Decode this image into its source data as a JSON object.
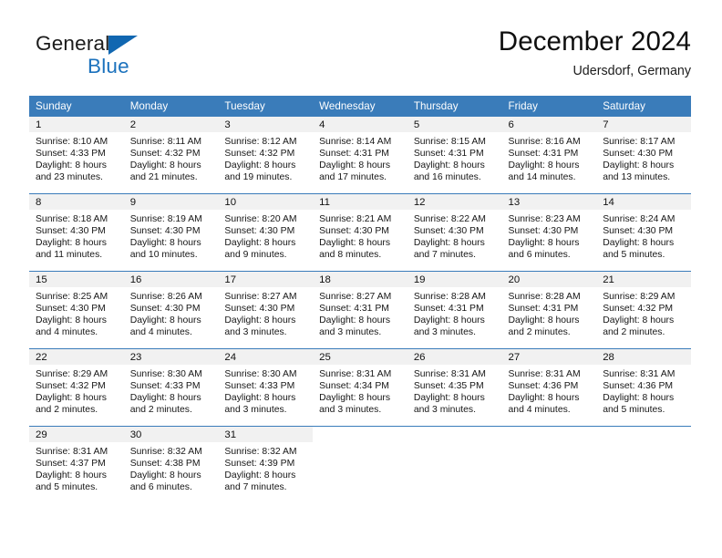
{
  "brand": {
    "name_part1": "General",
    "name_part2": "Blue",
    "triangle_color": "#1167b1",
    "blue_color": "#1c72bd"
  },
  "header": {
    "title": "December 2024",
    "subtitle": "Udersdorf, Germany"
  },
  "theme": {
    "header_blue": "#3a7cba",
    "daynum_band": "#f1f1f1",
    "text": "#161616"
  },
  "weekdays": [
    "Sunday",
    "Monday",
    "Tuesday",
    "Wednesday",
    "Thursday",
    "Friday",
    "Saturday"
  ],
  "labels": {
    "sunrise_prefix": "Sunrise:",
    "sunset_prefix": "Sunset:",
    "daylight_prefix": "Daylight:"
  },
  "weeks": [
    [
      {
        "day": "1",
        "sunrise": "Sunrise: 8:10 AM",
        "sunset": "Sunset: 4:33 PM",
        "daylight_l1": "Daylight: 8 hours",
        "daylight_l2": "and 23 minutes."
      },
      {
        "day": "2",
        "sunrise": "Sunrise: 8:11 AM",
        "sunset": "Sunset: 4:32 PM",
        "daylight_l1": "Daylight: 8 hours",
        "daylight_l2": "and 21 minutes."
      },
      {
        "day": "3",
        "sunrise": "Sunrise: 8:12 AM",
        "sunset": "Sunset: 4:32 PM",
        "daylight_l1": "Daylight: 8 hours",
        "daylight_l2": "and 19 minutes."
      },
      {
        "day": "4",
        "sunrise": "Sunrise: 8:14 AM",
        "sunset": "Sunset: 4:31 PM",
        "daylight_l1": "Daylight: 8 hours",
        "daylight_l2": "and 17 minutes."
      },
      {
        "day": "5",
        "sunrise": "Sunrise: 8:15 AM",
        "sunset": "Sunset: 4:31 PM",
        "daylight_l1": "Daylight: 8 hours",
        "daylight_l2": "and 16 minutes."
      },
      {
        "day": "6",
        "sunrise": "Sunrise: 8:16 AM",
        "sunset": "Sunset: 4:31 PM",
        "daylight_l1": "Daylight: 8 hours",
        "daylight_l2": "and 14 minutes."
      },
      {
        "day": "7",
        "sunrise": "Sunrise: 8:17 AM",
        "sunset": "Sunset: 4:30 PM",
        "daylight_l1": "Daylight: 8 hours",
        "daylight_l2": "and 13 minutes."
      }
    ],
    [
      {
        "day": "8",
        "sunrise": "Sunrise: 8:18 AM",
        "sunset": "Sunset: 4:30 PM",
        "daylight_l1": "Daylight: 8 hours",
        "daylight_l2": "and 11 minutes."
      },
      {
        "day": "9",
        "sunrise": "Sunrise: 8:19 AM",
        "sunset": "Sunset: 4:30 PM",
        "daylight_l1": "Daylight: 8 hours",
        "daylight_l2": "and 10 minutes."
      },
      {
        "day": "10",
        "sunrise": "Sunrise: 8:20 AM",
        "sunset": "Sunset: 4:30 PM",
        "daylight_l1": "Daylight: 8 hours",
        "daylight_l2": "and 9 minutes."
      },
      {
        "day": "11",
        "sunrise": "Sunrise: 8:21 AM",
        "sunset": "Sunset: 4:30 PM",
        "daylight_l1": "Daylight: 8 hours",
        "daylight_l2": "and 8 minutes."
      },
      {
        "day": "12",
        "sunrise": "Sunrise: 8:22 AM",
        "sunset": "Sunset: 4:30 PM",
        "daylight_l1": "Daylight: 8 hours",
        "daylight_l2": "and 7 minutes."
      },
      {
        "day": "13",
        "sunrise": "Sunrise: 8:23 AM",
        "sunset": "Sunset: 4:30 PM",
        "daylight_l1": "Daylight: 8 hours",
        "daylight_l2": "and 6 minutes."
      },
      {
        "day": "14",
        "sunrise": "Sunrise: 8:24 AM",
        "sunset": "Sunset: 4:30 PM",
        "daylight_l1": "Daylight: 8 hours",
        "daylight_l2": "and 5 minutes."
      }
    ],
    [
      {
        "day": "15",
        "sunrise": "Sunrise: 8:25 AM",
        "sunset": "Sunset: 4:30 PM",
        "daylight_l1": "Daylight: 8 hours",
        "daylight_l2": "and 4 minutes."
      },
      {
        "day": "16",
        "sunrise": "Sunrise: 8:26 AM",
        "sunset": "Sunset: 4:30 PM",
        "daylight_l1": "Daylight: 8 hours",
        "daylight_l2": "and 4 minutes."
      },
      {
        "day": "17",
        "sunrise": "Sunrise: 8:27 AM",
        "sunset": "Sunset: 4:30 PM",
        "daylight_l1": "Daylight: 8 hours",
        "daylight_l2": "and 3 minutes."
      },
      {
        "day": "18",
        "sunrise": "Sunrise: 8:27 AM",
        "sunset": "Sunset: 4:31 PM",
        "daylight_l1": "Daylight: 8 hours",
        "daylight_l2": "and 3 minutes."
      },
      {
        "day": "19",
        "sunrise": "Sunrise: 8:28 AM",
        "sunset": "Sunset: 4:31 PM",
        "daylight_l1": "Daylight: 8 hours",
        "daylight_l2": "and 3 minutes."
      },
      {
        "day": "20",
        "sunrise": "Sunrise: 8:28 AM",
        "sunset": "Sunset: 4:31 PM",
        "daylight_l1": "Daylight: 8 hours",
        "daylight_l2": "and 2 minutes."
      },
      {
        "day": "21",
        "sunrise": "Sunrise: 8:29 AM",
        "sunset": "Sunset: 4:32 PM",
        "daylight_l1": "Daylight: 8 hours",
        "daylight_l2": "and 2 minutes."
      }
    ],
    [
      {
        "day": "22",
        "sunrise": "Sunrise: 8:29 AM",
        "sunset": "Sunset: 4:32 PM",
        "daylight_l1": "Daylight: 8 hours",
        "daylight_l2": "and 2 minutes."
      },
      {
        "day": "23",
        "sunrise": "Sunrise: 8:30 AM",
        "sunset": "Sunset: 4:33 PM",
        "daylight_l1": "Daylight: 8 hours",
        "daylight_l2": "and 2 minutes."
      },
      {
        "day": "24",
        "sunrise": "Sunrise: 8:30 AM",
        "sunset": "Sunset: 4:33 PM",
        "daylight_l1": "Daylight: 8 hours",
        "daylight_l2": "and 3 minutes."
      },
      {
        "day": "25",
        "sunrise": "Sunrise: 8:31 AM",
        "sunset": "Sunset: 4:34 PM",
        "daylight_l1": "Daylight: 8 hours",
        "daylight_l2": "and 3 minutes."
      },
      {
        "day": "26",
        "sunrise": "Sunrise: 8:31 AM",
        "sunset": "Sunset: 4:35 PM",
        "daylight_l1": "Daylight: 8 hours",
        "daylight_l2": "and 3 minutes."
      },
      {
        "day": "27",
        "sunrise": "Sunrise: 8:31 AM",
        "sunset": "Sunset: 4:36 PM",
        "daylight_l1": "Daylight: 8 hours",
        "daylight_l2": "and 4 minutes."
      },
      {
        "day": "28",
        "sunrise": "Sunrise: 8:31 AM",
        "sunset": "Sunset: 4:36 PM",
        "daylight_l1": "Daylight: 8 hours",
        "daylight_l2": "and 5 minutes."
      }
    ],
    [
      {
        "day": "29",
        "sunrise": "Sunrise: 8:31 AM",
        "sunset": "Sunset: 4:37 PM",
        "daylight_l1": "Daylight: 8 hours",
        "daylight_l2": "and 5 minutes."
      },
      {
        "day": "30",
        "sunrise": "Sunrise: 8:32 AM",
        "sunset": "Sunset: 4:38 PM",
        "daylight_l1": "Daylight: 8 hours",
        "daylight_l2": "and 6 minutes."
      },
      {
        "day": "31",
        "sunrise": "Sunrise: 8:32 AM",
        "sunset": "Sunset: 4:39 PM",
        "daylight_l1": "Daylight: 8 hours",
        "daylight_l2": "and 7 minutes."
      },
      {
        "day": "",
        "sunrise": "",
        "sunset": "",
        "daylight_l1": "",
        "daylight_l2": ""
      },
      {
        "day": "",
        "sunrise": "",
        "sunset": "",
        "daylight_l1": "",
        "daylight_l2": ""
      },
      {
        "day": "",
        "sunrise": "",
        "sunset": "",
        "daylight_l1": "",
        "daylight_l2": ""
      },
      {
        "day": "",
        "sunrise": "",
        "sunset": "",
        "daylight_l1": "",
        "daylight_l2": ""
      }
    ]
  ]
}
